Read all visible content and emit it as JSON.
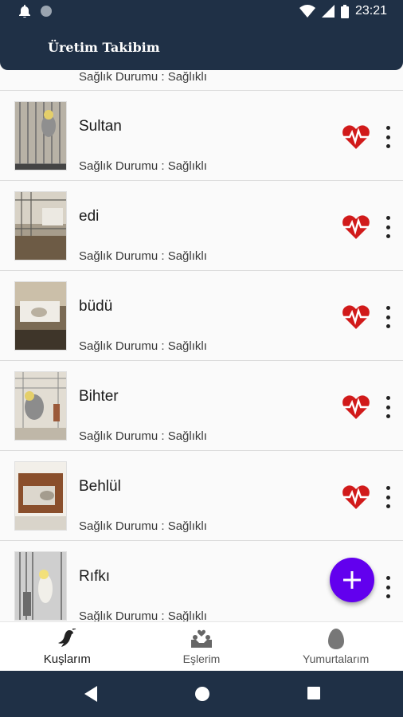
{
  "status_bar": {
    "time": "23:21"
  },
  "app_bar": {
    "title": "Üretim Takibim"
  },
  "partial_item": {
    "health": "Sağlık Durumu : Sağlıklı"
  },
  "birds": [
    {
      "name": "Sultan",
      "health": "Sağlık Durumu : Sağlıklı",
      "photo": "photo-sultan"
    },
    {
      "name": "edi",
      "health": "Sağlık Durumu : Sağlıklı",
      "photo": "photo-edi"
    },
    {
      "name": "büdü",
      "health": "Sağlık Durumu : Sağlıklı",
      "photo": "photo-budu"
    },
    {
      "name": "Bihter",
      "health": "Sağlık Durumu : Sağlıklı",
      "photo": "photo-bihter"
    },
    {
      "name": "Behlül",
      "health": "Sağlık Durumu : Sağlıklı",
      "photo": "photo-behlul"
    },
    {
      "name": "Rıfkı",
      "health": "Sağlık Durumu : Sağlıklı",
      "photo": "photo-rifki"
    }
  ],
  "bottom_nav": {
    "tabs": [
      {
        "label": "Kuşlarım",
        "icon": "bird-icon",
        "active": true
      },
      {
        "label": "Eşlerim",
        "icon": "pair-nest-icon",
        "active": false
      },
      {
        "label": "Yumurtalarım",
        "icon": "egg-icon",
        "active": false
      }
    ]
  },
  "colors": {
    "app_bar": "#1f3046",
    "heart": "#d11a1a",
    "fab": "#6200ee"
  }
}
